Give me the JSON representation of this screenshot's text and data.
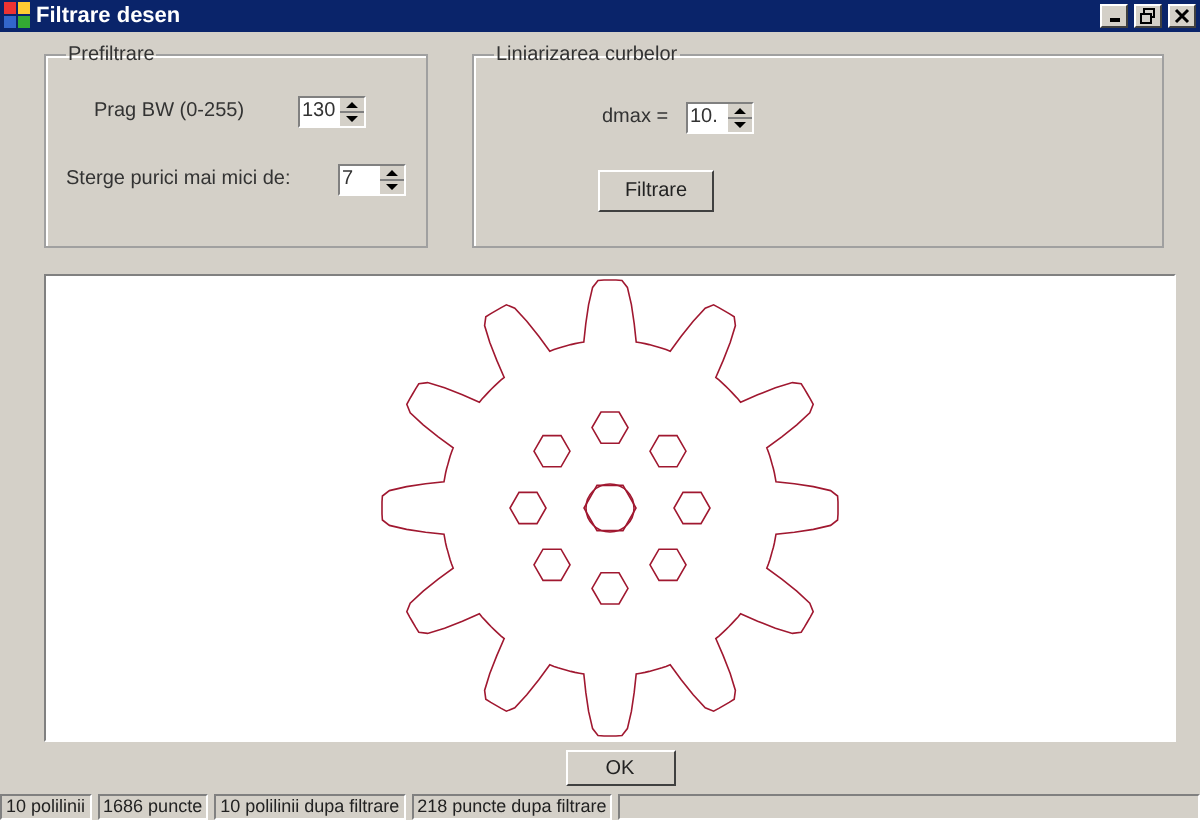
{
  "window": {
    "title": "Filtrare desen"
  },
  "prefiltrare": {
    "title": "Prefiltrare",
    "fields": [
      {
        "label": "Prag BW (0-255)",
        "value": "130"
      },
      {
        "label": "Sterge purici mai mici de:",
        "value": "7"
      }
    ]
  },
  "liniarizare": {
    "title": "Liniarizarea curbelor",
    "field": {
      "label": "dmax =",
      "value": "10."
    },
    "button": "Filtrare"
  },
  "ok_button": "OK",
  "status_bar": [
    "10 polilinii",
    "1686 puncte",
    "10 polilinii dupa filtrare",
    "218 puncte dupa filtrare"
  ]
}
